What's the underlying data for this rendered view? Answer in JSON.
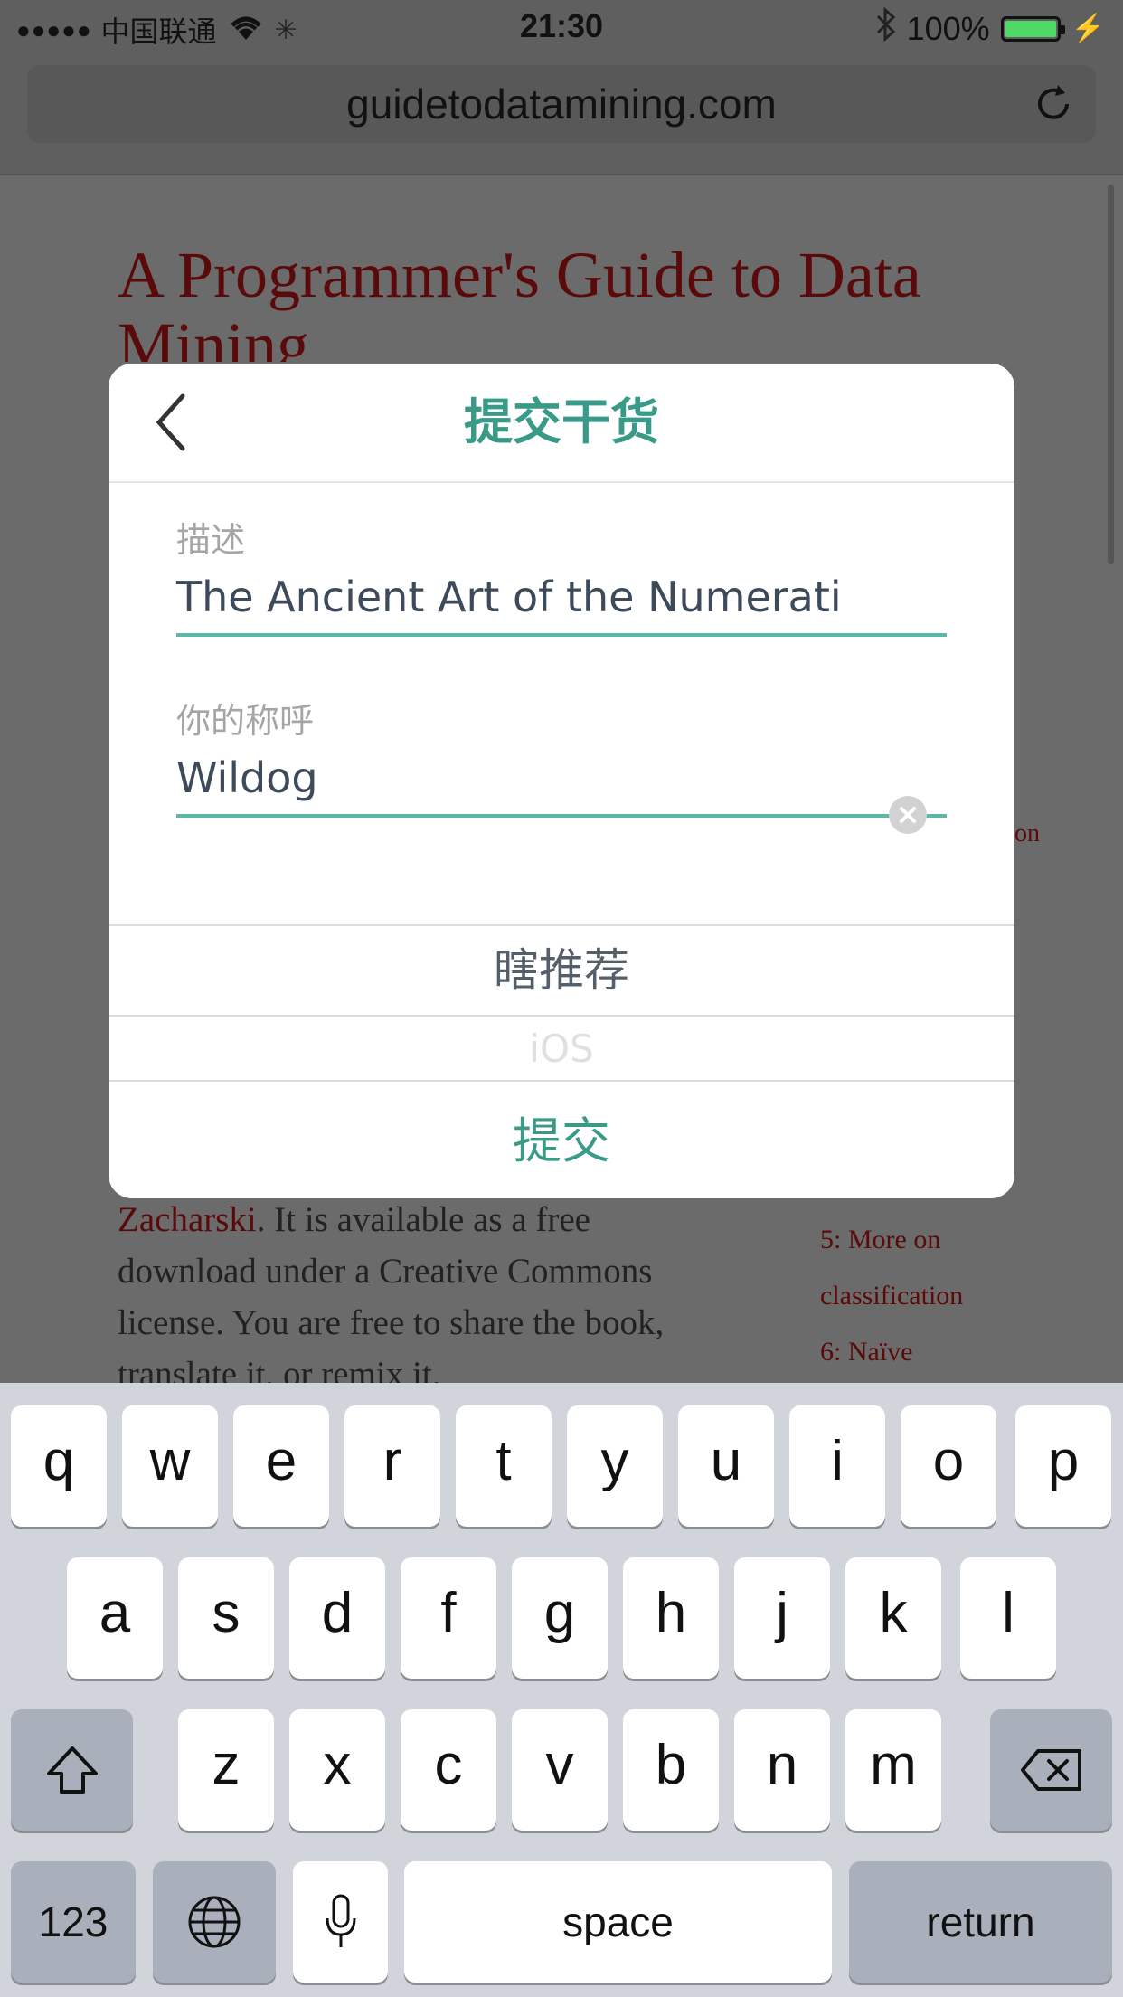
{
  "status_bar": {
    "signal": "●●●●●",
    "carrier": "中国联通",
    "time": "21:30",
    "battery": "100%"
  },
  "browser": {
    "url": "guidetodatamining.com"
  },
  "webpage": {
    "title": "A Programmer's Guide to Data Mining",
    "body_author": "Zacharski",
    "body_text": ". It is available as a free download under a Creative Commons license. You are free to share the book, translate it, or remix it.",
    "side_fragment": "on",
    "side_links": [
      "5: More on",
      "classification",
      "6: Naïve"
    ]
  },
  "modal": {
    "title": "提交干货",
    "fields": [
      {
        "label": "描述",
        "value": "The Ancient Art of the Numerati"
      },
      {
        "label": "你的称呼",
        "value": "Wildog"
      }
    ],
    "options": [
      "瞎推荐",
      "iOS"
    ],
    "submit_label": "提交",
    "accent_color": "#3a9a88"
  },
  "keyboard": {
    "row1": [
      "q",
      "w",
      "e",
      "r",
      "t",
      "y",
      "u",
      "i",
      "o",
      "p"
    ],
    "row2": [
      "a",
      "s",
      "d",
      "f",
      "g",
      "h",
      "j",
      "k",
      "l"
    ],
    "row3": [
      "z",
      "x",
      "c",
      "v",
      "b",
      "n",
      "m"
    ],
    "numbers_label": "123",
    "space_label": "space",
    "return_label": "return"
  }
}
